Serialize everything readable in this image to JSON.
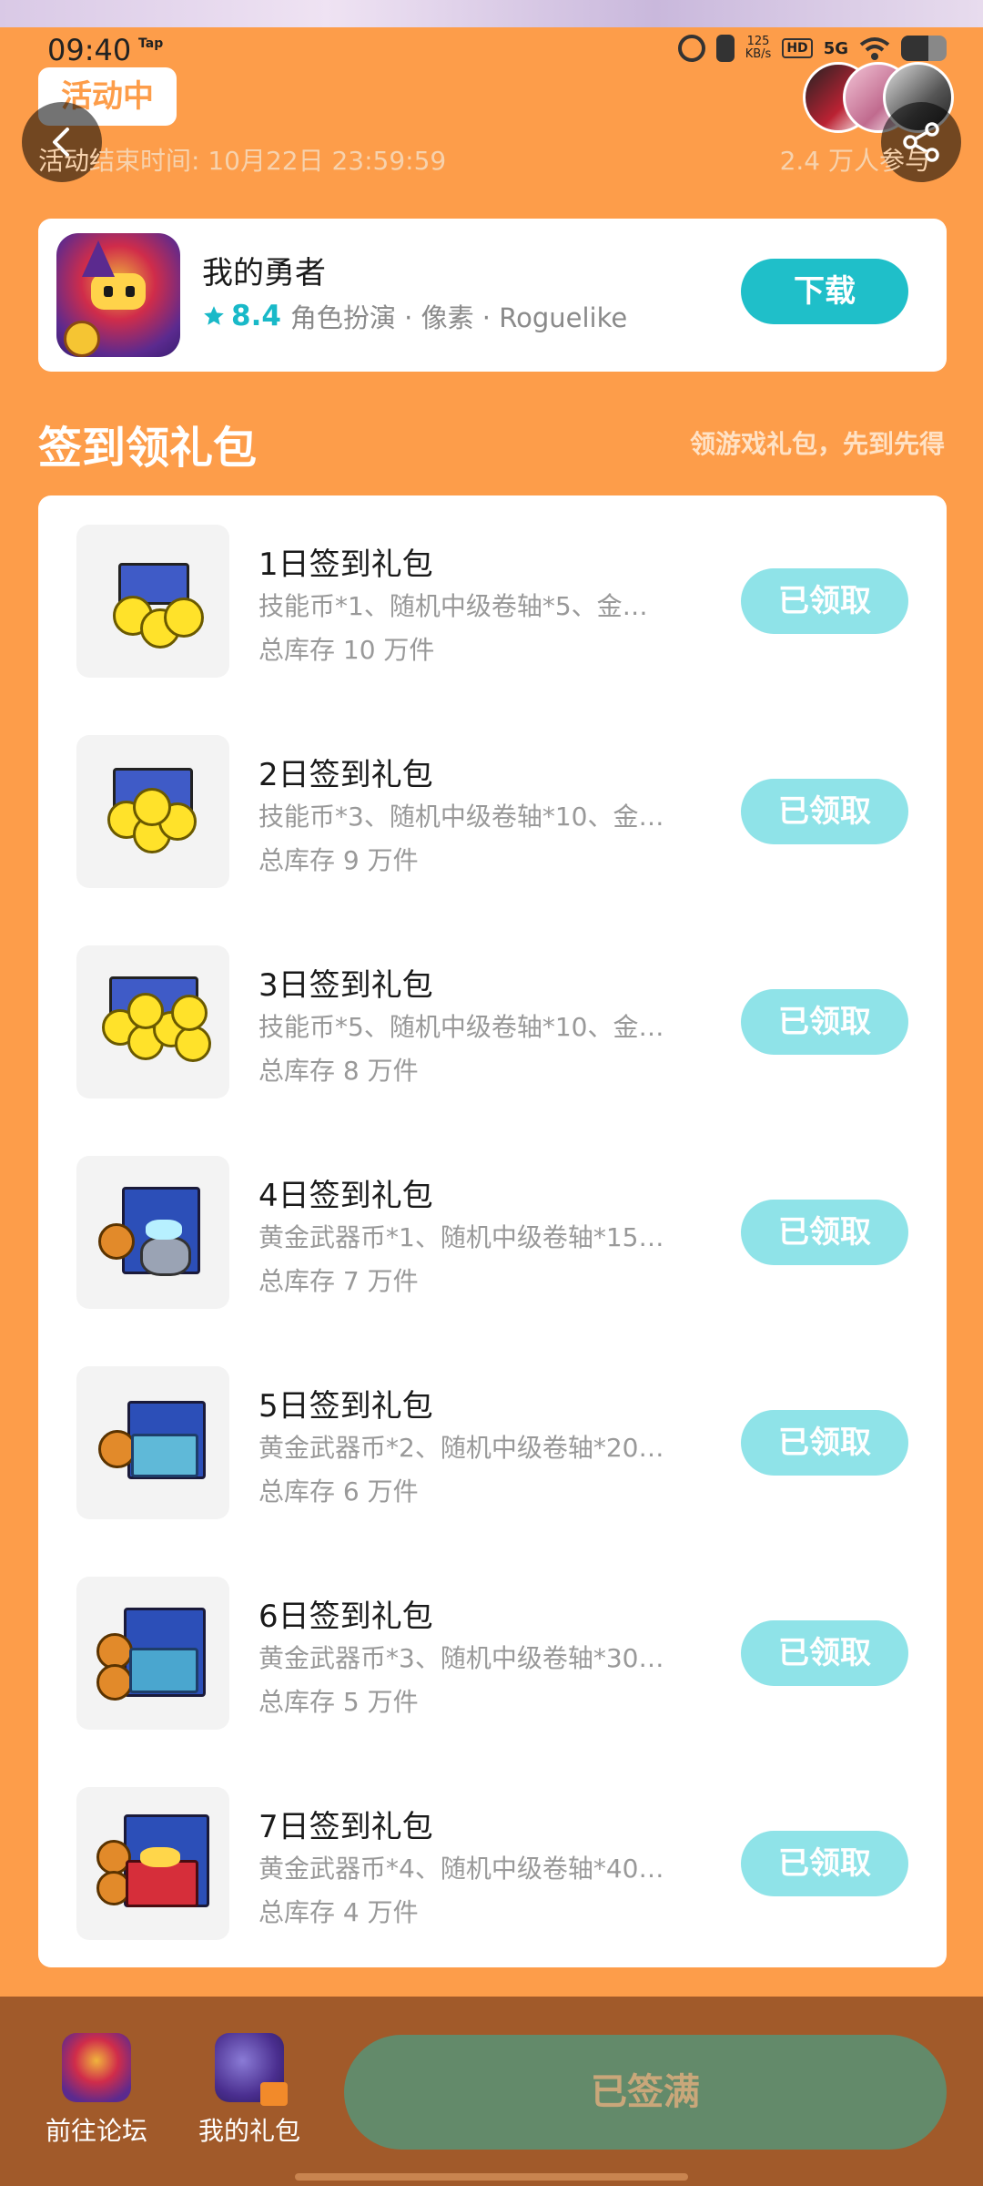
{
  "status_bar": {
    "time": "09:40",
    "carrier_tag": "Tap",
    "network_speed": "125",
    "network_unit": "KB/s",
    "hd": "HD",
    "signal": "5G"
  },
  "header": {
    "badge": "活动中",
    "end_time": "活动结束时间: 10月22日 23:59:59",
    "participants": "2.4 万人参与"
  },
  "game": {
    "name": "我的勇者",
    "rating": "8.4",
    "tags": "角色扮演 · 像素 · Roguelike",
    "download_label": "下载"
  },
  "section": {
    "title": "签到领礼包",
    "subtitle": "领游戏礼包，先到先得"
  },
  "gifts": [
    {
      "title": "1日签到礼包",
      "desc": "技能币*1、随机中级卷轴*5、金…",
      "stock": "总库存 10 万件",
      "action": "已领取"
    },
    {
      "title": "2日签到礼包",
      "desc": "技能币*3、随机中级卷轴*10、金…",
      "stock": "总库存 9 万件",
      "action": "已领取"
    },
    {
      "title": "3日签到礼包",
      "desc": "技能币*5、随机中级卷轴*10、金…",
      "stock": "总库存 8 万件",
      "action": "已领取"
    },
    {
      "title": "4日签到礼包",
      "desc": "黄金武器币*1、随机中级卷轴*15…",
      "stock": "总库存 7 万件",
      "action": "已领取"
    },
    {
      "title": "5日签到礼包",
      "desc": "黄金武器币*2、随机中级卷轴*20…",
      "stock": "总库存 6 万件",
      "action": "已领取"
    },
    {
      "title": "6日签到礼包",
      "desc": "黄金武器币*3、随机中级卷轴*30…",
      "stock": "总库存 5 万件",
      "action": "已领取"
    },
    {
      "title": "7日签到礼包",
      "desc": "黄金武器币*4、随机中级卷轴*40…",
      "stock": "总库存 4 万件",
      "action": "已领取"
    }
  ],
  "bottom_bar": {
    "forum_label": "前往论坛",
    "my_gifts_label": "我的礼包",
    "signed_label": "已签满"
  },
  "colors": {
    "page_bg": "#FD9D4A",
    "accent_teal": "#1FBFC9",
    "claimed_btn": "#8FE3E8",
    "bottom_bar": "#A15A2A",
    "signed_btn": "#638A6A"
  }
}
